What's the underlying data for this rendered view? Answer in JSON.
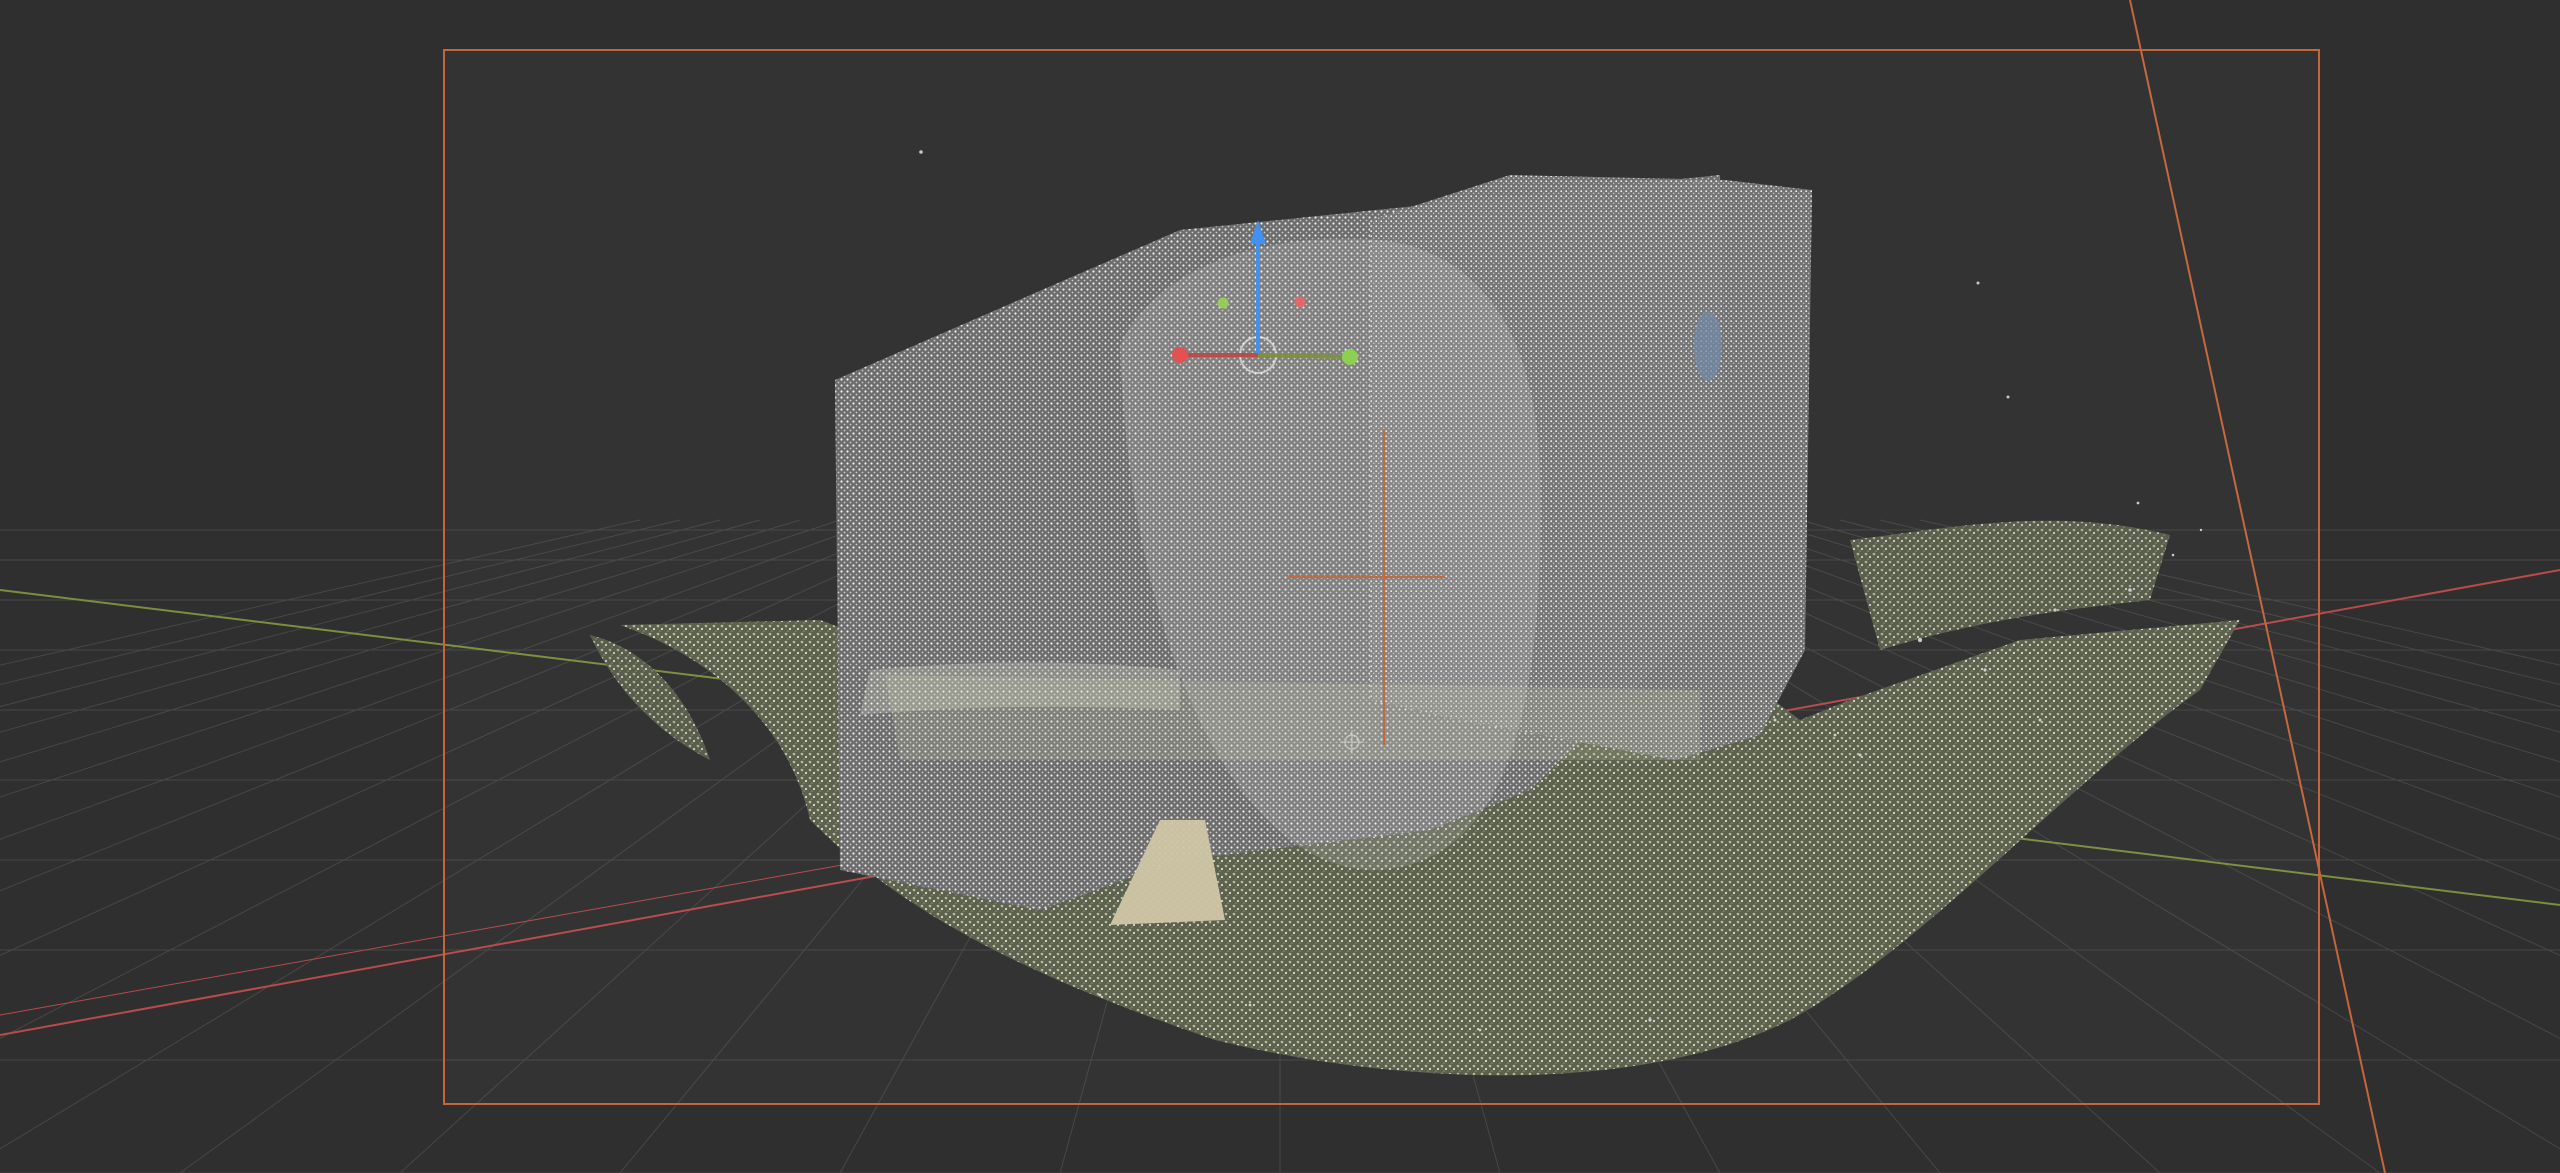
{
  "viewport": {
    "background_color": "#2f2f2f",
    "frame_color": "#c4663c"
  },
  "axes": {
    "x_axis_color": "#b84a4a",
    "y_axis_color": "#7a8f3e",
    "z_axis_color": "#3f8ef0"
  },
  "gizmo": {
    "icon": "transform-gizmo-icon"
  },
  "point_cloud": {
    "base_colors": [
      "#d8d8d8",
      "#a7ab89",
      "#c9c19b",
      "#e3e3e3"
    ]
  }
}
